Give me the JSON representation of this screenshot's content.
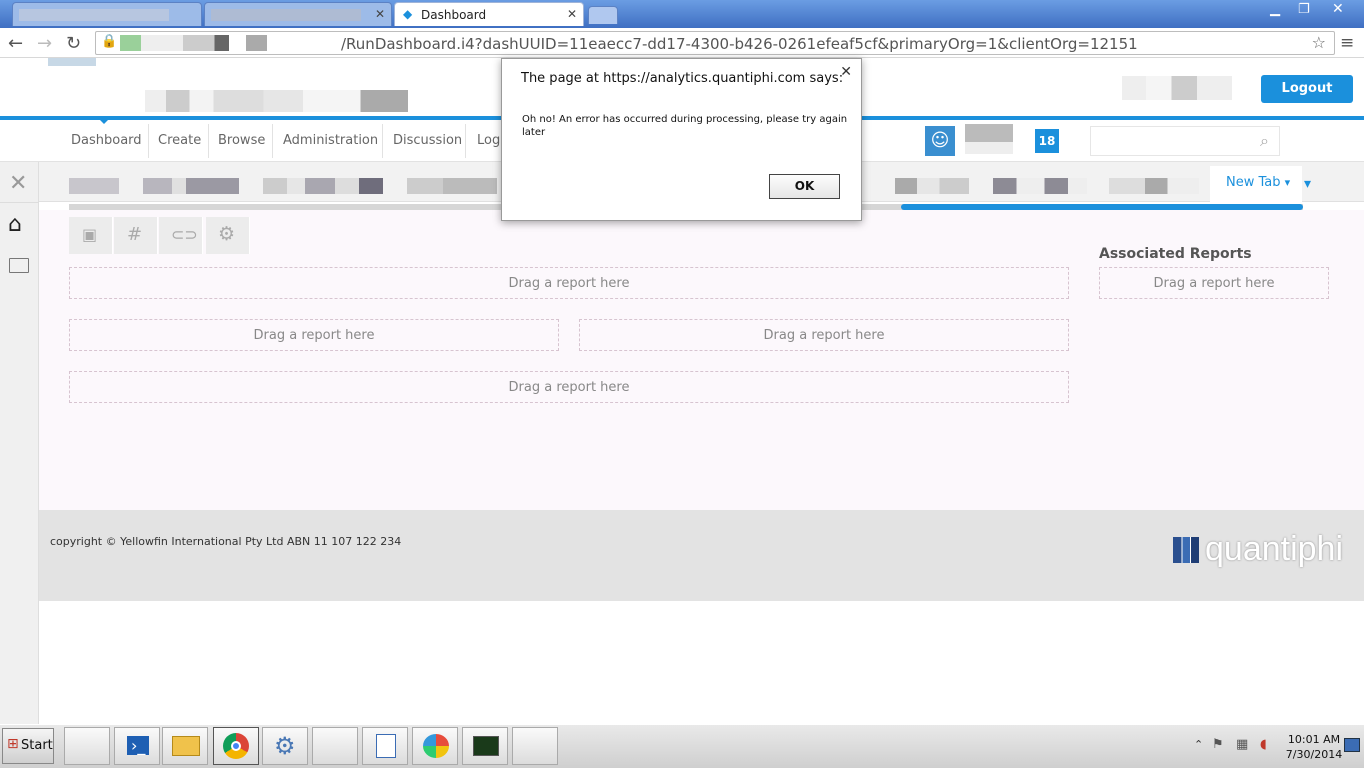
{
  "browser": {
    "active_tab_title": "Dashboard",
    "url": "/RunDashboard.i4?dashUUID=11eaecc7-dd17-4300-b426-0261efeaf5cf&primaryOrg=1&clientOrg=12151"
  },
  "header": {
    "logout_label": "Logout",
    "notifications_count": "18"
  },
  "nav": {
    "items": [
      "Dashboard",
      "Create",
      "Browse",
      "Administration",
      "Discussion",
      "Log"
    ]
  },
  "tabs": {
    "new_tab_label": "New Tab",
    "partial_label": "p"
  },
  "dashboard": {
    "drop_hint": "Drag a report here",
    "associated_title": "Associated Reports",
    "associated_drop_hint": "Drag a report here"
  },
  "footer": {
    "copyright": "copyright © Yellowfin International Pty Ltd ABN 11 107 122 234",
    "logo_text": "quantiphi"
  },
  "dialog": {
    "title": "The page at https://analytics.quantiphi.com says:",
    "message": "Oh no! An error has occurred during processing, please try again later",
    "ok_label": "OK"
  },
  "taskbar": {
    "start_label": "Start",
    "time": "10:01 AM",
    "date": "7/30/2014"
  },
  "colors": {
    "accent": "#1b90dc"
  }
}
